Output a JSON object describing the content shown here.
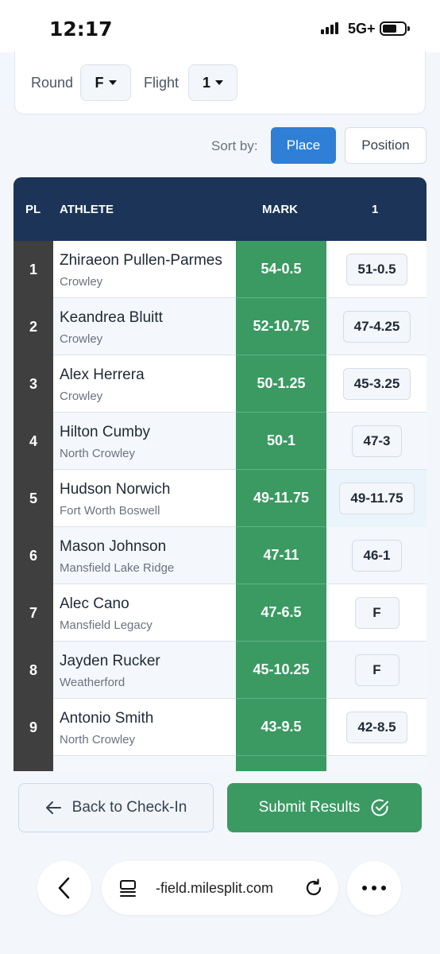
{
  "status_bar": {
    "time": "12:17",
    "network": "5G+"
  },
  "filters": {
    "round_label": "Round",
    "round_value": "F",
    "flight_label": "Flight",
    "flight_value": "1"
  },
  "sort": {
    "label": "Sort by:",
    "options": [
      "Place",
      "Position"
    ],
    "selected": "Place",
    "active_color": "#2f7fd6"
  },
  "table": {
    "headers": {
      "pl": "PL",
      "athlete": "ATHLETE",
      "mark": "MARK",
      "attempt": "1"
    },
    "header_color": "#1b3458",
    "mark_color": "#3a9a62",
    "rows": [
      {
        "place": "1",
        "name": "Zhiraeon Pullen-Parmes",
        "team": "Crowley",
        "mark": "54-0.5",
        "attempt1": "51-0.5"
      },
      {
        "place": "2",
        "name": "Keandrea Bluitt",
        "team": "Crowley",
        "mark": "52-10.75",
        "attempt1": "47-4.25"
      },
      {
        "place": "3",
        "name": "Alex Herrera",
        "team": "Crowley",
        "mark": "50-1.25",
        "attempt1": "45-3.25"
      },
      {
        "place": "4",
        "name": "Hilton Cumby",
        "team": "North Crowley",
        "mark": "50-1",
        "attempt1": "47-3"
      },
      {
        "place": "5",
        "name": "Hudson Norwich",
        "team": "Fort Worth Boswell",
        "mark": "49-11.75",
        "attempt1": "49-11.75"
      },
      {
        "place": "6",
        "name": "Mason Johnson",
        "team": "Mansfield Lake Ridge",
        "mark": "47-11",
        "attempt1": "46-1"
      },
      {
        "place": "7",
        "name": "Alec Cano",
        "team": "Mansfield Legacy",
        "mark": "47-6.5",
        "attempt1": "F"
      },
      {
        "place": "8",
        "name": "Jayden Rucker",
        "team": "Weatherford",
        "mark": "45-10.25",
        "attempt1": "F"
      },
      {
        "place": "9",
        "name": "Antonio Smith",
        "team": "North Crowley",
        "mark": "43-9.5",
        "attempt1": "42-8.5"
      }
    ]
  },
  "actions": {
    "back_label": "Back to Check-In",
    "submit_label": "Submit Results",
    "submit_color": "#3a9a62"
  },
  "browser": {
    "url": "-field.milesplit.com"
  }
}
